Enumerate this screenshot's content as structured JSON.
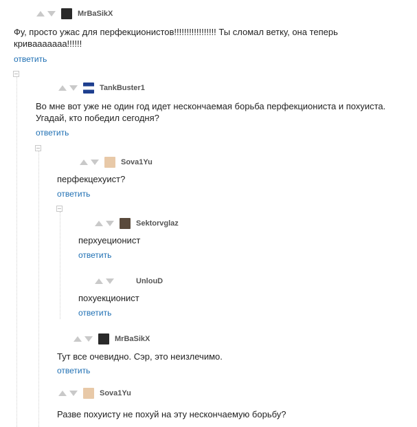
{
  "reply_label": "ответить",
  "comments": [
    {
      "user": "MrBaSikX",
      "text": "Фу, просто ужас для перфекционистов!!!!!!!!!!!!!!!!! Ты сломал ветку, она теперь кривааааааа!!!!!!"
    },
    {
      "user": "TankBuster1",
      "text": "Во мне вот уже не один год идет нескончаемая борьба перфекциониста и похуиста. Угадай, кто победил сегодня?"
    },
    {
      "user": "Sova1Yu",
      "text": "перфекцехуист?"
    },
    {
      "user": "Sektorvglaz",
      "text": "перхуеционист"
    },
    {
      "user": "UnlouD",
      "text": "похуекционист"
    },
    {
      "user": "MrBaSikX",
      "text": "Тут все очевидно. Сэр, это неизлечимо."
    },
    {
      "user": "Sova1Yu",
      "text": "Разве похуисту не похуй на эту нескончаемую борьбу?"
    }
  ]
}
